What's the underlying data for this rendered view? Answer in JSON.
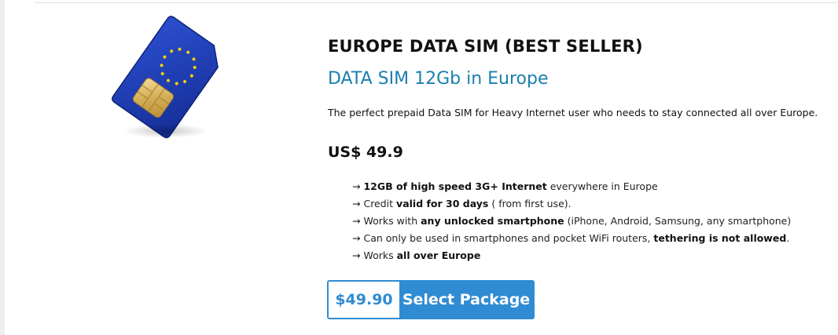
{
  "product": {
    "title": "EUROPE DATA SIM (BEST SELLER)",
    "subtitle": "DATA SIM 12Gb in Europe",
    "description": "The perfect prepaid Data SIM for Heavy Internet user who needs to stay connected all over Europe.",
    "price": "US$ 49.9",
    "image_icon": "eu-sim-card-icon"
  },
  "features": [
    {
      "arrow": "→",
      "pre": "",
      "bold": "12GB of high speed 3G+ Internet",
      "post": " everywhere in Europe"
    },
    {
      "arrow": "→",
      "pre": "Credit ",
      "bold": "valid for 30 days",
      "post": " ( from first use)."
    },
    {
      "arrow": "→",
      "pre": "Works with ",
      "bold": "any unlocked smartphone",
      "post": " (iPhone, Android, Samsung, any smartphone)"
    },
    {
      "arrow": "→",
      "pre": "Can only be used in smartphones and pocket WiFi routers, ",
      "bold": "tethering is not allowed",
      "post": "."
    },
    {
      "arrow": "→",
      "pre": "Works ",
      "bold": "all over Europe",
      "post": ""
    }
  ],
  "cta": {
    "price": "$49.90",
    "label": "Select Package",
    "color": "#2f8cd2"
  },
  "colors": {
    "subtitle": "#1b7fae",
    "sim_blue": "#1f3fb0",
    "stars": "#f5d10a",
    "chip": "#d9b85c"
  }
}
